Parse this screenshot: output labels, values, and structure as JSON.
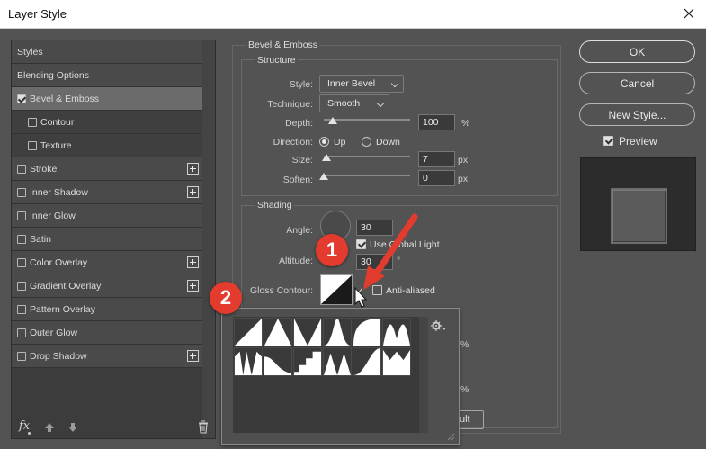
{
  "window": {
    "title": "Layer Style"
  },
  "styles_panel": {
    "items": [
      {
        "label": "Styles",
        "checkbox": false,
        "checked": false,
        "plus": false,
        "indent": false,
        "selected": false
      },
      {
        "label": "Blending Options",
        "checkbox": false,
        "checked": false,
        "plus": false,
        "indent": false,
        "selected": false
      },
      {
        "label": "Bevel & Emboss",
        "checkbox": true,
        "checked": true,
        "plus": false,
        "indent": false,
        "selected": true
      },
      {
        "label": "Contour",
        "checkbox": true,
        "checked": false,
        "plus": false,
        "indent": true,
        "selected": false
      },
      {
        "label": "Texture",
        "checkbox": true,
        "checked": false,
        "plus": false,
        "indent": true,
        "selected": false
      },
      {
        "label": "Stroke",
        "checkbox": true,
        "checked": false,
        "plus": true,
        "indent": false,
        "selected": false
      },
      {
        "label": "Inner Shadow",
        "checkbox": true,
        "checked": false,
        "plus": true,
        "indent": false,
        "selected": false
      },
      {
        "label": "Inner Glow",
        "checkbox": true,
        "checked": false,
        "plus": false,
        "indent": false,
        "selected": false
      },
      {
        "label": "Satin",
        "checkbox": true,
        "checked": false,
        "plus": false,
        "indent": false,
        "selected": false
      },
      {
        "label": "Color Overlay",
        "checkbox": true,
        "checked": false,
        "plus": true,
        "indent": false,
        "selected": false
      },
      {
        "label": "Gradient Overlay",
        "checkbox": true,
        "checked": false,
        "plus": true,
        "indent": false,
        "selected": false
      },
      {
        "label": "Pattern Overlay",
        "checkbox": true,
        "checked": false,
        "plus": false,
        "indent": false,
        "selected": false
      },
      {
        "label": "Outer Glow",
        "checkbox": true,
        "checked": false,
        "plus": false,
        "indent": false,
        "selected": false
      },
      {
        "label": "Drop Shadow",
        "checkbox": true,
        "checked": false,
        "plus": true,
        "indent": false,
        "selected": false
      }
    ],
    "fx_label": "fx"
  },
  "bevel": {
    "section_title": "Bevel & Emboss",
    "structure_title": "Structure",
    "style_label": "Style:",
    "style_value": "Inner Bevel",
    "technique_label": "Technique:",
    "technique_value": "Smooth",
    "depth_label": "Depth:",
    "depth_value": "100",
    "depth_unit": "%",
    "direction_label": "Direction:",
    "direction_up": "Up",
    "direction_down": "Down",
    "direction_selected": "Up",
    "size_label": "Size:",
    "size_value": "7",
    "size_unit": "px",
    "soften_label": "Soften:",
    "soften_value": "0",
    "soften_unit": "px",
    "depth_level": 0.1,
    "size_level": 0.03,
    "soften_level": 0.0
  },
  "shading": {
    "title": "Shading",
    "angle_label": "Angle:",
    "angle_value": "30",
    "global_light_label": "Use Global Light",
    "global_light_checked": true,
    "altitude_label": "Altitude:",
    "altitude_value": "30",
    "altitude_unit": "°",
    "gloss_contour_label": "Gloss Contour:",
    "anti_aliased_label": "Anti-aliased",
    "anti_aliased_checked": false,
    "hidden_unit_1": "%",
    "hidden_unit_2": "%",
    "hidden_button_tail": "ult"
  },
  "buttons": {
    "ok": "OK",
    "cancel": "Cancel",
    "new_style": "New Style...",
    "preview_label": "Preview",
    "preview_checked": true
  },
  "annotations": {
    "badge1": "1",
    "badge2": "2",
    "accent": "#e33b2e"
  },
  "contour_picker": {
    "rows": 2,
    "columns": 6,
    "items": [
      "Linear",
      "Cone",
      "Cone - Inverted",
      "Gaussian",
      "Half Round",
      "Ring",
      "Ring - Double",
      "Rolling Slope - Descending",
      "Rounded Steps",
      "Sawtooth 1",
      "Cove - Deep",
      "Cove - Shallow"
    ]
  }
}
